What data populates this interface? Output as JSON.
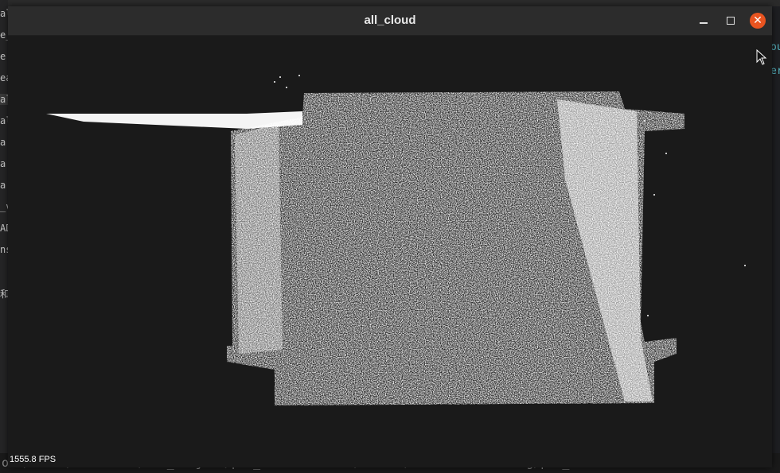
{
  "window": {
    "title": "all_cloud",
    "controls": {
      "minimize": "minimize",
      "maximize": "maximize",
      "close": "close"
    }
  },
  "viewer": {
    "fps_label": "1555.8 FPS",
    "background_color": "#1a1a1a",
    "point_color": "#ffffff"
  },
  "background_editor": {
    "left_sidebar_fragments": [
      "al",
      "e_",
      "e",
      "ea",
      "al",
      "al",
      "a.",
      "a.",
      "a.",
      "_v",
      "AD",
      "ns",
      "和"
    ],
    "right_fragments": [
      "ou",
      "er"
    ],
    "terminal_line": "ons/xubai/Documents/PCL_Project/pcl_visualization/source/cmake-build-debug/pcl_visualiza"
  },
  "colors": {
    "close_button": "#e95420",
    "titlebar": "#2c2c2c"
  }
}
